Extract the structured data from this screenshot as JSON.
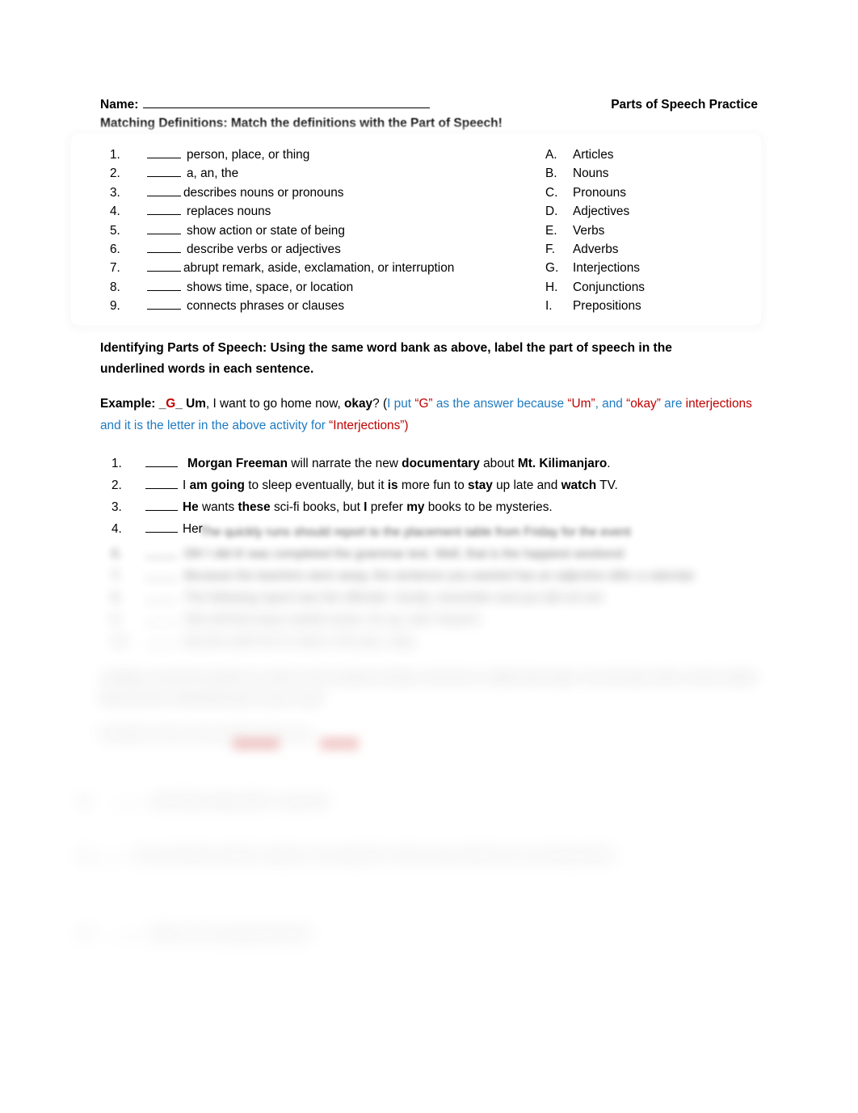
{
  "header": {
    "name_label": "Name:",
    "doc_title": "Parts of Speech Practice"
  },
  "subheading": "Matching Definitions:  Match the definitions with the Part of Speech!",
  "matching": {
    "definitions": [
      {
        "num": "1.",
        "text": "person, place, or thing"
      },
      {
        "num": "2.",
        "text": "a, an, the"
      },
      {
        "num": "3.",
        "text": "describes nouns or pronouns"
      },
      {
        "num": "4.",
        "text": "replaces nouns"
      },
      {
        "num": "5.",
        "text": "show action or state of being"
      },
      {
        "num": "6.",
        "text": "describe verbs or adjectives"
      },
      {
        "num": "7.",
        "text": "abrupt remark, aside, exclamation, or interruption"
      },
      {
        "num": "8.",
        "text": "shows time, space, or location"
      },
      {
        "num": "9.",
        "text": "connects phrases or clauses"
      }
    ],
    "word_bank": [
      {
        "letter": "A.",
        "label": "Articles"
      },
      {
        "letter": "B.",
        "label": "Nouns"
      },
      {
        "letter": "C.",
        "label": "Pronouns"
      },
      {
        "letter": "D.",
        "label": "Adjectives"
      },
      {
        "letter": "E.",
        "label": "Verbs"
      },
      {
        "letter": "F.",
        "label": "Adverbs"
      },
      {
        "letter": "G.",
        "label": "Interjections"
      },
      {
        "letter": "H.",
        "label": "Conjunctions"
      },
      {
        "letter": "I.",
        "label": "Prepositions"
      }
    ]
  },
  "instructions": "Identifying Parts of Speech: Using the same word bank as above, label the part of speech in the underlined words in each sentence.",
  "example": {
    "label": "Example:",
    "blank_open": "_",
    "answer_letter": "G",
    "blank_close": "_",
    "word_um": "Um",
    "sentence_mid": ", I want to go home now, ",
    "word_okay": "okay",
    "q_paren": "? (",
    "exp_1": "I put ",
    "exp_quote_g": "“G”",
    "exp_2": " as the answer because ",
    "exp_quote_um": "“Um”",
    "exp_3": ", and ",
    "exp_quote_okay": "“okay”",
    "exp_4": " are ",
    "exp_interjections": "interjections",
    "exp_5": " and it is the letter in the above activity for ",
    "exp_quote_interj": "“Interjections”)"
  },
  "sentences": [
    {
      "num": "1.",
      "parts": [
        {
          "t": "Morgan Freeman",
          "b": true
        },
        {
          "t": " will narrate the new ",
          "b": false
        },
        {
          "t": "documentary",
          "b": true
        },
        {
          "t": " about ",
          "b": false
        },
        {
          "t": "Mt. Kilimanjaro",
          "b": true
        },
        {
          "t": ".",
          "b": false
        }
      ]
    },
    {
      "num": "2.",
      "parts": [
        {
          "t": "I ",
          "b": false
        },
        {
          "t": "am going",
          "b": true
        },
        {
          "t": " to sleep eventually, but it ",
          "b": false
        },
        {
          "t": "is",
          "b": true
        },
        {
          "t": " more fun to ",
          "b": false
        },
        {
          "t": "stay",
          "b": true
        },
        {
          "t": " up late and ",
          "b": false
        },
        {
          "t": "watch",
          "b": true
        },
        {
          "t": " TV.",
          "b": false
        }
      ]
    },
    {
      "num": "3.",
      "parts": [
        {
          "t": "He",
          "b": true
        },
        {
          "t": " wants ",
          "b": false
        },
        {
          "t": "these",
          "b": true
        },
        {
          "t": " sci-fi books, but ",
          "b": false
        },
        {
          "t": "I",
          "b": true
        },
        {
          "t": " prefer ",
          "b": false
        },
        {
          "t": "my",
          "b": true
        },
        {
          "t": " books to be mysteries.",
          "b": false
        }
      ]
    },
    {
      "num": "4.",
      "parts": [
        {
          "t": "Her",
          "b": false
        }
      ]
    }
  ],
  "obscured": {
    "note": "Lower portion of the page is progressively blurred and illegible.",
    "rows": [
      {
        "num": "5.",
        "text": "The quickly runs should report to the placement table from Friday for the event"
      },
      {
        "num": "6.",
        "text": "Oh! I did it! was completed the grammar test.  Well, that is the happiest weekend"
      },
      {
        "num": "7.",
        "text": "Because the teachers were away, the sentence you wanted has an adjective after a calendar"
      },
      {
        "num": "8.",
        "text": "The following report was the offender.  Surely, remember and you did not win"
      },
      {
        "num": "9.",
        "text": "She will find many careful nouns, for up, and I found it"
      },
      {
        "num": "10.",
        "text": "My time with him   to mark in the quiz,  okay"
      }
    ],
    "paragraph": "Looking a word for practice in order in the sentence below.    And this is called that study. You will also write a short article that has the underlined part of your read.",
    "example_line": "Example:  She is the people that to you",
    "tail_rows": [
      {
        "num": "11.",
        "text": "Josh likes today after a cup from"
      },
      {
        "num": "12.",
        "text": "He has family carried to object to his people for when sing a field are too and big written"
      },
      {
        "num": "13.",
        "text": "When are we going that day?"
      }
    ]
  }
}
